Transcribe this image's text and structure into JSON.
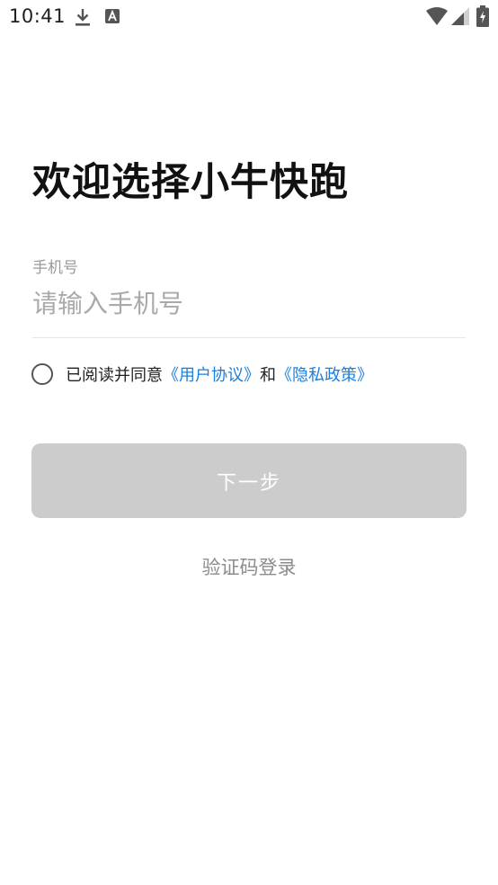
{
  "status_bar": {
    "time": "10:41",
    "icons": [
      "download-icon",
      "a-icon",
      "wifi-icon",
      "signal-icon",
      "battery-icon"
    ]
  },
  "login": {
    "title": "欢迎选择小牛快跑",
    "phone_label": "手机号",
    "phone_placeholder": "请输入手机号",
    "phone_value": "",
    "agreement": {
      "checked": false,
      "prefix": "已阅读并同意",
      "user_agreement": "《用户协议》",
      "connector": "和",
      "privacy_policy": "《隐私政策》"
    },
    "next_button": "下一步",
    "sms_login": "验证码登录"
  },
  "colors": {
    "link": "#1a7fe0",
    "button_disabled": "#cccccc",
    "label_gray": "#9a9a9a"
  }
}
